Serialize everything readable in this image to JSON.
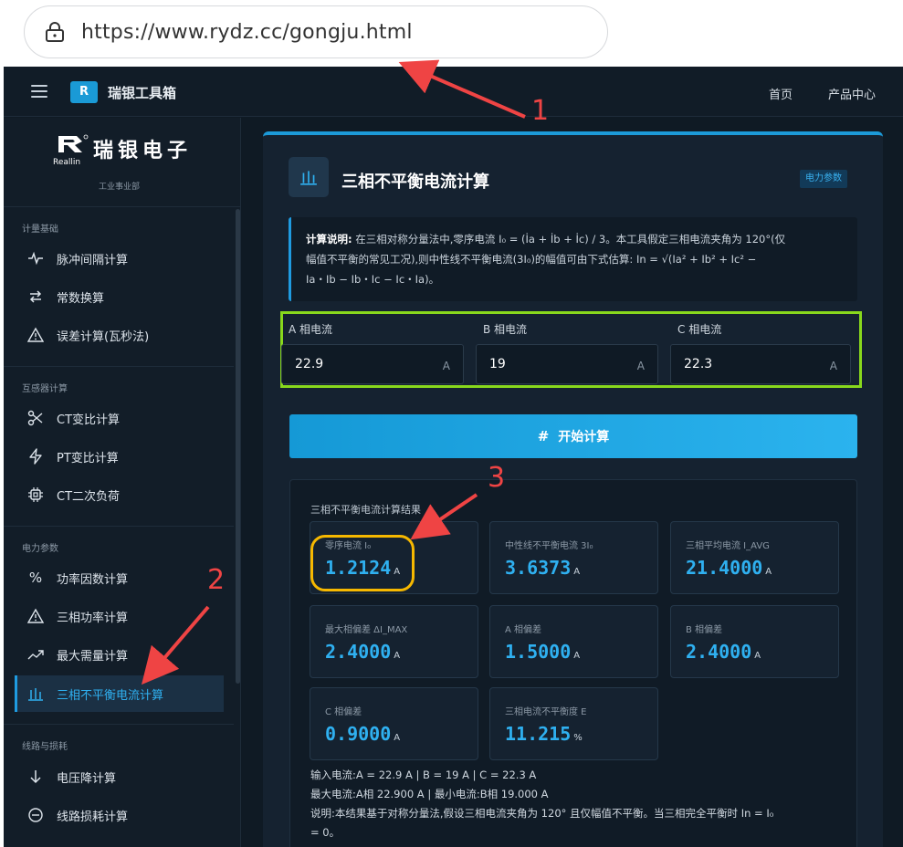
{
  "browser": {
    "url": "https://www.rydz.cc/gongju.html"
  },
  "topnav": {
    "brand_letter": "R",
    "brand_name": "瑞银工具箱",
    "home": "首页",
    "products": "产品中心"
  },
  "sidebar": {
    "company_name": "瑞银电子",
    "company_sub": "工业事业部",
    "logo_text": "Reallin",
    "sections": [
      {
        "title": "计量基础",
        "items": [
          {
            "label": "脉冲间隔计算",
            "icon": "pulse-icon"
          },
          {
            "label": "常数换算",
            "icon": "swap-icon"
          },
          {
            "label": "误差计算(瓦秒法)",
            "icon": "warning-icon"
          }
        ]
      },
      {
        "title": "互感器计算",
        "items": [
          {
            "label": "CT变比计算",
            "icon": "scissors-icon"
          },
          {
            "label": "PT变比计算",
            "icon": "lightning-icon"
          },
          {
            "label": "CT二次负荷",
            "icon": "chip-icon"
          }
        ]
      },
      {
        "title": "电力参数",
        "items": [
          {
            "label": "功率因数计算",
            "icon": "percent-icon"
          },
          {
            "label": "三相功率计算",
            "icon": "warning-icon"
          },
          {
            "label": "最大需量计算",
            "icon": "trend-icon"
          },
          {
            "label": "三相不平衡电流计算",
            "icon": "bars-icon",
            "active": true
          }
        ]
      },
      {
        "title": "线路与损耗",
        "items": [
          {
            "label": "电压降计算",
            "icon": "arrow-down-icon"
          },
          {
            "label": "线路损耗计算",
            "icon": "minus-circle-icon"
          }
        ]
      }
    ]
  },
  "main": {
    "title": "三相不平衡电流计算",
    "tag": "电力参数",
    "explain_bold": "计算说明:",
    "explain_line1": "在三相对称分量法中,零序电流 I₀ = (İa + İb + İc) / 3。本工具假定三相电流夹角为 120°(仅",
    "explain_line2": "幅值不平衡的常见工况),则中性线不平衡电流(3I₀)的幅值可由下式估算: In = √(Ia² + Ib² + Ic² −",
    "explain_line3": "Ia・Ib − Ib・Ic − Ic・Ia)。",
    "inputs": [
      {
        "label": "A 相电流",
        "value": "22.9",
        "unit": "A"
      },
      {
        "label": "B 相电流",
        "value": "19",
        "unit": "A"
      },
      {
        "label": "C 相电流",
        "value": "22.3",
        "unit": "A"
      }
    ],
    "button_icon": "#",
    "button_label": "开始计算",
    "result_title": "三相不平衡电流计算结果",
    "results": [
      {
        "label": "零序电流 I₀",
        "value": "1.2124",
        "unit": "A"
      },
      {
        "label": "中性线不平衡电流 3I₀",
        "value": "3.6373",
        "unit": "A"
      },
      {
        "label": "三相平均电流 I_AVG",
        "value": "21.4000",
        "unit": "A"
      },
      {
        "label": "最大相偏差 ΔI_MAX",
        "value": "2.4000",
        "unit": "A"
      },
      {
        "label": "A 相偏差",
        "value": "1.5000",
        "unit": "A"
      },
      {
        "label": "B 相偏差",
        "value": "2.4000",
        "unit": "A"
      },
      {
        "label": "C 相偏差",
        "value": "0.9000",
        "unit": "A"
      },
      {
        "label": "三相电流不平衡度 E",
        "value": "11.215",
        "unit": "%"
      }
    ],
    "summary_line1": "输入电流:A = 22.9 A | B = 19 A | C = 22.3 A",
    "summary_line2": "最大电流:A相 22.900 A | 最小电流:B相 19.000 A",
    "summary_line3": "说明:本结果基于对称分量法,假设三相电流夹角为 120° 且仅幅值不平衡。当三相完全平衡时 In = I₀",
    "summary_line4": "= 0。"
  },
  "annotations": {
    "one": "1",
    "two": "2",
    "three": "3",
    "color": "#ef4444",
    "circle_color": "#f6b800",
    "box_color": "#88d81c"
  }
}
